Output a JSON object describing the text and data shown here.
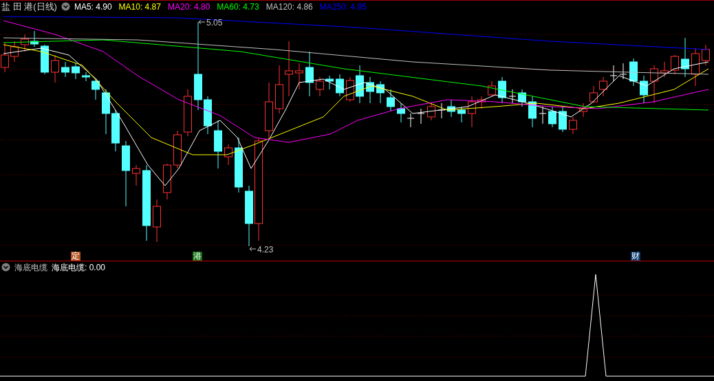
{
  "main_pane": {
    "title": "盐 田 港(日线)",
    "indicators": [
      {
        "label": "MA5: 4.90",
        "color": "#ffffff"
      },
      {
        "label": "MA10: 4.87",
        "color": "#ffff00"
      },
      {
        "label": "MA20: 4.80",
        "color": "#ff00ff"
      },
      {
        "label": "MA60: 4.73",
        "color": "#00ff00"
      },
      {
        "label": "MA120: 4.86",
        "color": "#c0c0c0"
      },
      {
        "label": "MA250: 4.95",
        "color": "#0000ff"
      }
    ],
    "price_marks": [
      {
        "kind": "high",
        "label": "5.05"
      },
      {
        "kind": "low",
        "label": "4.23"
      }
    ],
    "event_markers": [
      {
        "label": "定",
        "color": "#b4501e"
      },
      {
        "label": "港",
        "color": "#107010"
      },
      {
        "label": "财",
        "color": "#0a3a6e"
      }
    ]
  },
  "sub_pane": {
    "title": "海底电缆",
    "reading": "海底电缆: 0.00"
  }
}
